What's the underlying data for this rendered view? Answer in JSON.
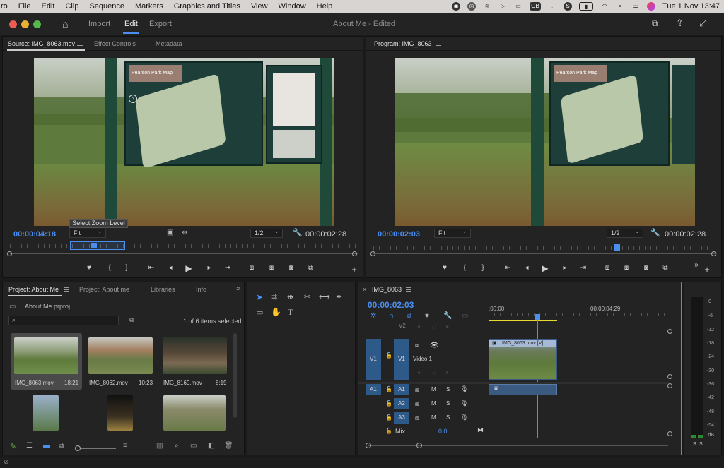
{
  "menubar": {
    "app": "ro",
    "items": [
      "File",
      "Edit",
      "Clip",
      "Sequence",
      "Markers",
      "Graphics and Titles",
      "View",
      "Window",
      "Help"
    ],
    "datetime": "Tue 1 Nov  13:47",
    "gb_badge": "GB"
  },
  "window": {
    "title": "About Me - Edited",
    "nav": [
      "Import",
      "Edit",
      "Export"
    ]
  },
  "source": {
    "tab": "Source: IMG_8063.mov",
    "tabs": [
      "Effect Controls",
      "Metadata"
    ],
    "timecode": "00:00:04:18",
    "zoom": "Fit",
    "res": "1/2",
    "duration": "00:00:02:28",
    "tooltip": "Select Zoom Level",
    "map_label": "Pearson Park Map"
  },
  "program": {
    "tab": "Program: IMG_8063",
    "timecode": "00:00:02:03",
    "zoom": "Fit",
    "res": "1/2",
    "duration": "00:00:02:28",
    "map_label": "Pearson Park Map"
  },
  "project": {
    "tabs": [
      "Project: About Me",
      "Project: About me",
      "Libraries",
      "Info"
    ],
    "file": "About Me.prproj",
    "selection": "1 of 6 items selected",
    "items": [
      {
        "name": "IMG_8063.mov",
        "dur": "18:21"
      },
      {
        "name": "IMG_8062.mov",
        "dur": "10:23"
      },
      {
        "name": "IMG_8169.mov",
        "dur": "8:19"
      },
      {
        "name": "",
        "dur": ""
      },
      {
        "name": "",
        "dur": ""
      },
      {
        "name": "",
        "dur": ""
      }
    ]
  },
  "timeline": {
    "tab": "IMG_8063",
    "timecode": "00:00:02:03",
    "ruler": [
      ":00:00",
      "00:00:04:29"
    ],
    "clip": "IMG_8063.mov [V]",
    "tracks": {
      "v2": "V2",
      "v1": "V1",
      "video1": "Video 1",
      "a1": "A1",
      "a2": "A2",
      "a3": "A3",
      "mix": "Mix",
      "mix_val": "0.0",
      "v1_src": "V1",
      "a1_src": "A1"
    },
    "m": "M",
    "s": "S"
  },
  "meter": {
    "labels": [
      "0",
      "-6",
      "-12",
      "-18",
      "-24",
      "-30",
      "-36",
      "-42",
      "-48",
      "-54",
      "dB"
    ],
    "solo": [
      "S",
      "S"
    ]
  }
}
